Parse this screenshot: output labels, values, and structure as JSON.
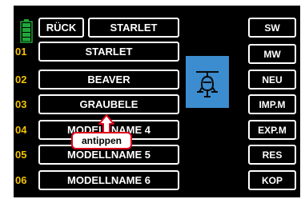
{
  "header": {
    "back_label": "RÜCK",
    "model_title": "STARLET"
  },
  "model_list": [
    {
      "index": "01",
      "name": "STARLET"
    },
    {
      "index": "02",
      "name": "BEAVER"
    },
    {
      "index": "03",
      "name": "GRAUBELE"
    },
    {
      "index": "04",
      "name": "MODELLNAME 4"
    },
    {
      "index": "05",
      "name": "MODELLNAME 5"
    },
    {
      "index": "06",
      "name": "MODELLNAME 6"
    }
  ],
  "side_buttons": [
    "SW",
    "MW",
    "NEU",
    "IMP.M",
    "EXP.M",
    "RES",
    "KOP"
  ],
  "callout": {
    "text": "antippen"
  },
  "icons": {
    "battery": "battery-icon",
    "model_type": "helicopter-icon"
  },
  "colors": {
    "accent_number": "#f3c200",
    "model_tile": "#3c8dcf",
    "battery": "#22a63a",
    "callout_border": "#e0001b"
  }
}
